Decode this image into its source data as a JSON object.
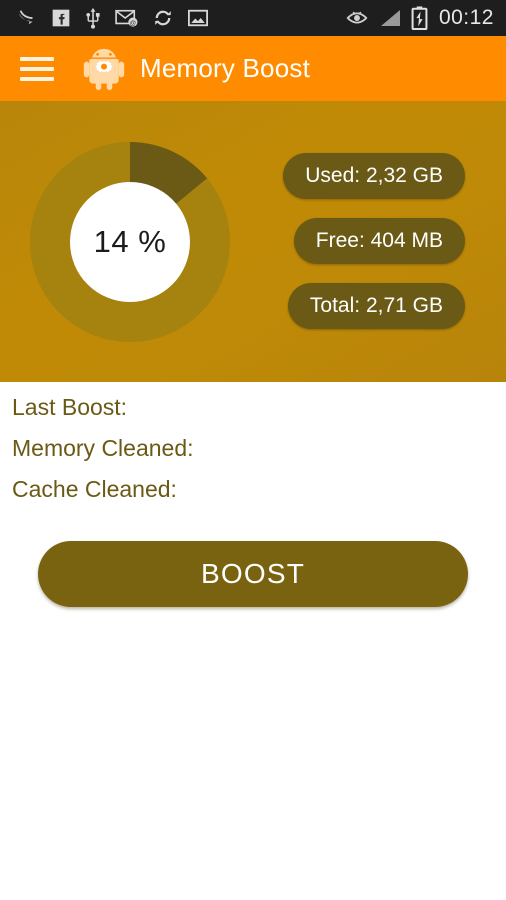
{
  "statusbar": {
    "time": "00:12",
    "left_icons": [
      {
        "name": "swoosh-icon"
      },
      {
        "name": "facebook-icon"
      },
      {
        "name": "usb-icon"
      },
      {
        "name": "email-icon"
      },
      {
        "name": "sync-icon"
      },
      {
        "name": "gallery-image-icon"
      }
    ],
    "right_icons": [
      {
        "name": "smart-stay-eye-icon"
      },
      {
        "name": "signal-bars-icon"
      },
      {
        "name": "battery-charging-icon"
      }
    ]
  },
  "appbar": {
    "menu_icon": "hamburger-menu-icon",
    "logo_icon": "android-gear-robot-icon",
    "title": "Memory Boost",
    "background_color": "#ff8c00"
  },
  "memory_panel": {
    "background_color": "#bf8a07",
    "percent_label": "14 %",
    "badges": [
      {
        "label": "Used: 2,32 GB"
      },
      {
        "label": "Free: 404 MB"
      },
      {
        "label": "Total: 2,71 GB"
      }
    ],
    "badge_color": "#6b5a16"
  },
  "chart_data": {
    "type": "pie",
    "title": "Memory usage",
    "categories": [
      "Used",
      "Free"
    ],
    "values": [
      14,
      86
    ],
    "units": "percent",
    "center_label": "14 %",
    "colors": [
      "#6b5a16",
      "#a6820e"
    ],
    "donut": true,
    "start_angle": 0,
    "legend": "right"
  },
  "stats": {
    "rows": [
      {
        "label": "Last Boost:",
        "value": ""
      },
      {
        "label": "Memory Cleaned:",
        "value": ""
      },
      {
        "label": "Cache Cleaned:",
        "value": ""
      }
    ],
    "text_color": "#6b5a16"
  },
  "actions": {
    "boost_label": "BOOST",
    "boost_color": "#7a6310"
  }
}
